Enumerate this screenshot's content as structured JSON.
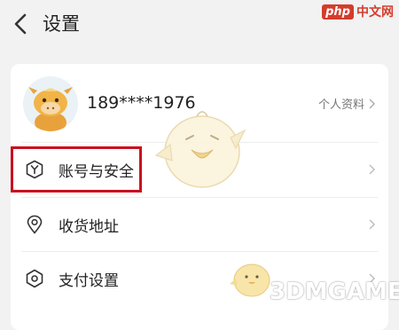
{
  "header": {
    "title": "设置"
  },
  "watermark": {
    "brand": "php",
    "site": "中文网",
    "game_site": "3DMGAME"
  },
  "profile": {
    "phone": "189****1976",
    "link_label": "个人资料"
  },
  "menu": [
    {
      "label": "账号与安全",
      "icon": "shield-y-icon"
    },
    {
      "label": "收货地址",
      "icon": "location-pin-icon"
    },
    {
      "label": "支付设置",
      "icon": "payment-gear-icon"
    }
  ],
  "colors": {
    "highlight": "#c8101f",
    "background": "#f2f2f2",
    "card": "#ffffff"
  }
}
